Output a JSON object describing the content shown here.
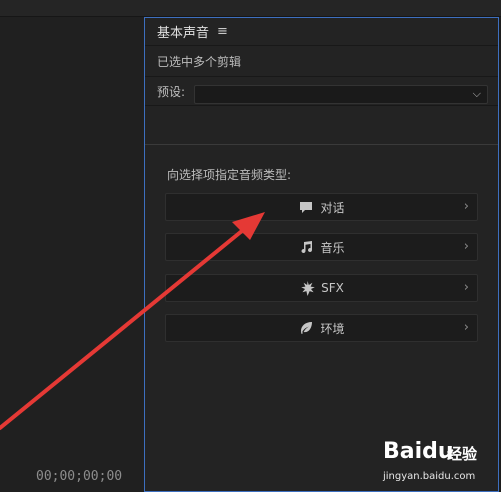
{
  "timeline": {
    "timecode": "00;00;00;00"
  },
  "panel": {
    "title": "基本声音",
    "menu_icon": "hamburger-icon",
    "selection_status": "已选中多个剪辑",
    "preset_label": "预设:",
    "preset_value": "",
    "prompt": "向选择项指定音频类型:",
    "types": [
      {
        "label": "对话",
        "icon": "speech-bubble-icon"
      },
      {
        "label": "音乐",
        "icon": "music-note-icon"
      },
      {
        "label": "SFX",
        "icon": "burst-icon"
      },
      {
        "label": "环境",
        "icon": "leaf-icon"
      }
    ]
  },
  "annotation": {
    "arrow_color": "#e53935"
  },
  "watermark": {
    "brand": "Bai",
    "brand_du": "du",
    "cn": "经验",
    "url": "jingyan.baidu.com"
  },
  "colors": {
    "accent_border": "#3d6fbf",
    "background": "#1d1d1d"
  }
}
